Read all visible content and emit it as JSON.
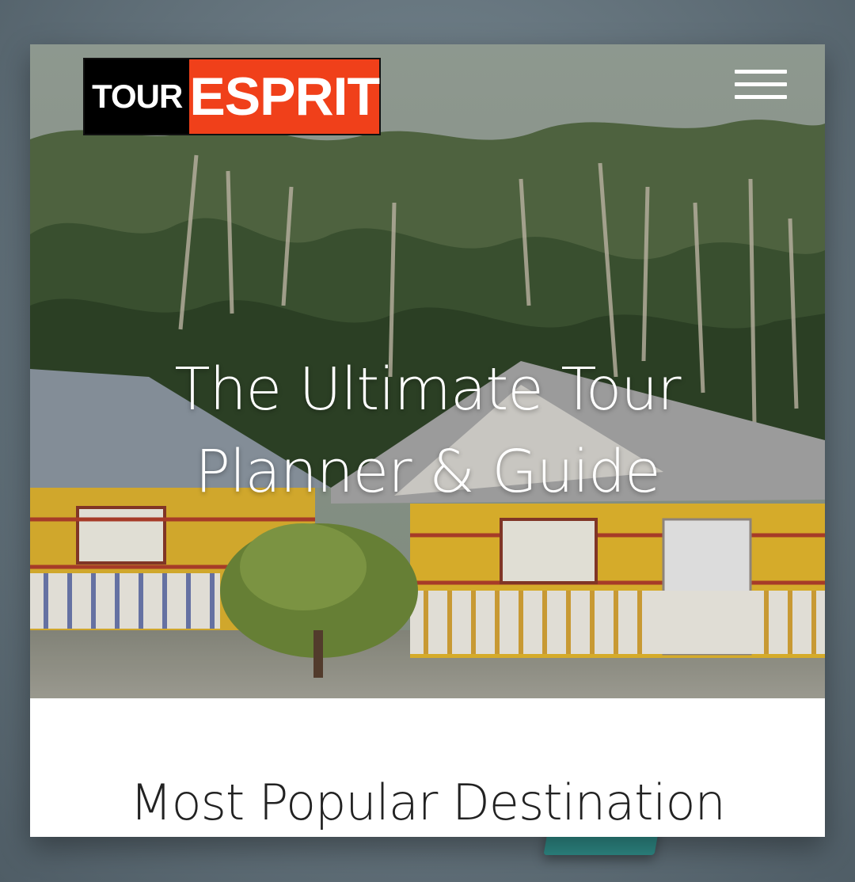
{
  "logo": {
    "word1": "TOUR",
    "word2": "ESPRIT",
    "word1_bg": "#000000",
    "word2_bg": "#f0401a"
  },
  "menu": {
    "icon": "hamburger-menu-icon"
  },
  "hero": {
    "title_line1": "The Ultimate Tour",
    "title_line2": "Planner & Guide",
    "image": "forest-cottages-photo"
  },
  "section": {
    "title": "Most Popular Destination"
  }
}
